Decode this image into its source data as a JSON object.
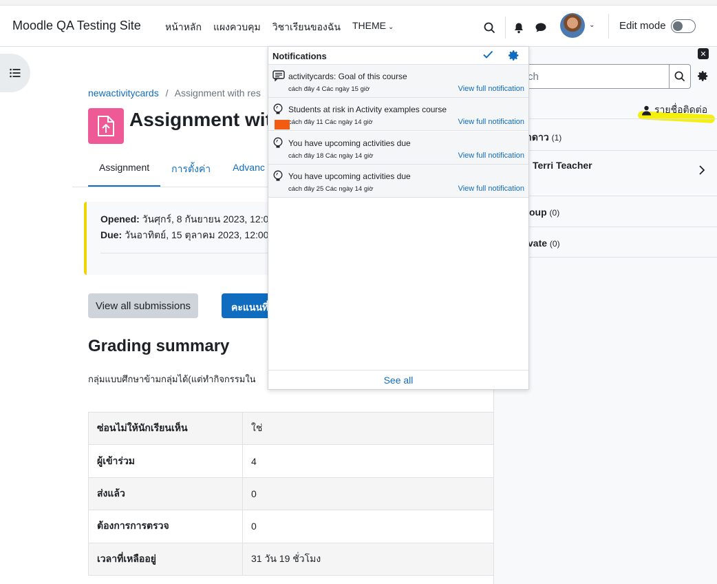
{
  "navbar": {
    "brand": "Moodle QA Testing Site",
    "links": [
      "หน้าหลัก",
      "แผงควบคุม",
      "วิชาเรียนของฉัน",
      "THEME"
    ],
    "edit_mode_label": "Edit mode",
    "edit_mode_on": false
  },
  "breadcrumb": {
    "course": "newactivitycards",
    "separator": "/",
    "current": "Assignment with res"
  },
  "page": {
    "title": "Assignment wit",
    "tabs": [
      "Assignment",
      "การตั้งค่า",
      "Advanc"
    ],
    "opened_label": "Opened:",
    "opened_value": "วันศุกร์, 8 กันยายน 2023, 12:0",
    "due_label": "Due:",
    "due_value": "วันอาทิตย์, 15 ตุลาคม 2023, 12:00",
    "view_all_button": "View all submissions",
    "grade_button": "คะแนนที่"
  },
  "grading": {
    "title": "Grading summary",
    "note": "กลุ่มแบบศึกษาข้ามกลุ่มได้(แต่ทำกิจกรรมใน",
    "rows": [
      {
        "label": "ซ่อนไม่ให้นักเรียนเห็น",
        "value": "ใช่"
      },
      {
        "label": "ผู้เข้าร่วม",
        "value": "4"
      },
      {
        "label": "ส่งแล้ว",
        "value": "0"
      },
      {
        "label": "ต้องการการตรวจ",
        "value": "0"
      },
      {
        "label": "เวลาที่เหลืออยู่",
        "value": "31 วัน 19 ชั่วโมง"
      }
    ]
  },
  "drawer": {
    "search_placeholder": "ch",
    "contacts_label": "รายชื่อติดต่อ",
    "sections": [
      {
        "label": "าดาว",
        "count": "(1)"
      },
      {
        "label": "Terri Teacher",
        "count": ""
      },
      {
        "label": "oup",
        "count": "(0)"
      },
      {
        "label": "vate",
        "count": "(0)"
      }
    ]
  },
  "notifications": {
    "title": "Notifications",
    "items": [
      {
        "text": "activitycards: Goal of this course",
        "time": "cách đây 4 Các ngày 15 giờ",
        "link": "View full notification",
        "icon": "message-icon"
      },
      {
        "text": "Students at risk in Activity examples course",
        "time": "cách đây 11 Các ngày 14 giờ",
        "link": "View full notification",
        "icon": "lightbulb-icon"
      },
      {
        "text": "You have upcoming activities due",
        "time": "cách đây 18 Các ngày 14 giờ",
        "link": "View full notification",
        "icon": "lightbulb-icon"
      },
      {
        "text": "You have upcoming activities due",
        "time": "cách đây 25 Các ngày 14 giờ",
        "link": "View full notification",
        "icon": "lightbulb-icon"
      }
    ],
    "see_all": "See all"
  },
  "colors": {
    "brand_blue": "#0f6cbf",
    "activity_icon": "#ee5a96",
    "due_bar": "#f0d400",
    "highlight": "#f4ee00"
  }
}
